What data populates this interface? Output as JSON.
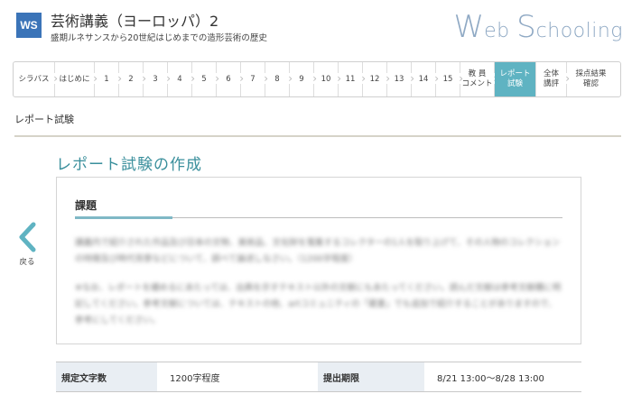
{
  "header": {
    "badge": "WS",
    "title": "芸術講義（ヨーロッパ）2",
    "subtitle": "盛期ルネサンスから20世紀はじめまでの造形芸術の歴史",
    "logo_w": "W",
    "logo_eb": "eb ",
    "logo_s": "S",
    "logo_chooling": "chooling"
  },
  "nav": {
    "items": [
      {
        "label": "シラバス"
      },
      {
        "label": "はじめに"
      },
      {
        "label": "1"
      },
      {
        "label": "2"
      },
      {
        "label": "3"
      },
      {
        "label": "4"
      },
      {
        "label": "5"
      },
      {
        "label": "6"
      },
      {
        "label": "7"
      },
      {
        "label": "8"
      },
      {
        "label": "9"
      },
      {
        "label": "10"
      },
      {
        "label": "11"
      },
      {
        "label": "12"
      },
      {
        "label": "13"
      },
      {
        "label": "14"
      },
      {
        "label": "15"
      },
      {
        "line1": "教 員",
        "line2": "コメント"
      },
      {
        "line1": "レポート",
        "line2": "試験"
      },
      {
        "line1": "全体",
        "line2": "講評"
      },
      {
        "line1": "採点結果",
        "line2": "確認"
      }
    ],
    "active_index": 18,
    "active_color": "#5fb3c2"
  },
  "breadcrumb": "レポート試験",
  "section_title": "レポート試験の作成",
  "back": {
    "label": "戻る"
  },
  "panel": {
    "heading": "課題",
    "paragraph1": "講義内で紹介された作品及び日本の文物、美術品、文化財を蒐集するコレクターの1人を取り上げて、その人物のコレクションの特徴及び時代背景などについて、調べて論述しなさい。（1200字程度）",
    "paragraph2": "※なお、レポートを纏めるにあたっては、出典を示すテキスト以外の文献にもあたってください。読んだ文献は参考文献欄に明記してください。参考文献については、テキストの他、artコミュニティの「蔵書」でも追加で紹介することがありますので、参考にしてください。"
  },
  "info": {
    "word_count_label": "規定文字数",
    "word_count_value": "1200字程度",
    "deadline_label": "提出期限",
    "deadline_value": "8/21 13:00～8/28 13:00"
  }
}
